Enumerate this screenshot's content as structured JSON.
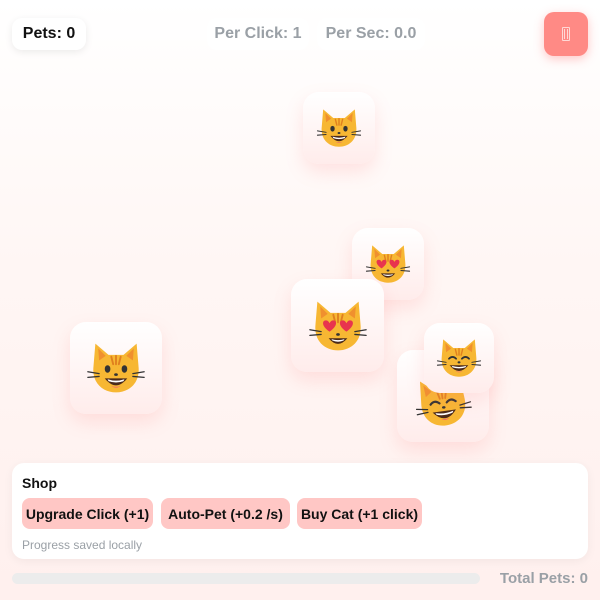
{
  "stats": {
    "pets": "Pets: 0",
    "per_click": "Per Click: 1",
    "per_sec": "Per Sec: 0.0"
  },
  "reset_button": {
    "icon": "hourglass-icon",
    "color": "#ff8a85"
  },
  "cats": [
    {
      "expression": "smiling-cat-icon"
    },
    {
      "expression": "heart-eyes-cat-icon"
    },
    {
      "expression": "heart-eyes-cat-icon"
    },
    {
      "expression": "smiling-cat-icon"
    },
    {
      "expression": "grinning-cat-icon"
    },
    {
      "expression": "smiling-cat-icon"
    }
  ],
  "shop": {
    "title": "Shop",
    "buttons": {
      "upgrade": "Upgrade Click (+1)",
      "autopet": "Auto-Pet (+0.2 /s)",
      "buycat": "Buy Cat (+1 click)"
    },
    "note": "Progress saved locally"
  },
  "progress": {
    "fraction": 0
  },
  "total_pets": "Total Pets: 0",
  "colors": {
    "accent": "#ff8a85",
    "button": "#ffc7c5",
    "muted": "#9aa0a6"
  }
}
